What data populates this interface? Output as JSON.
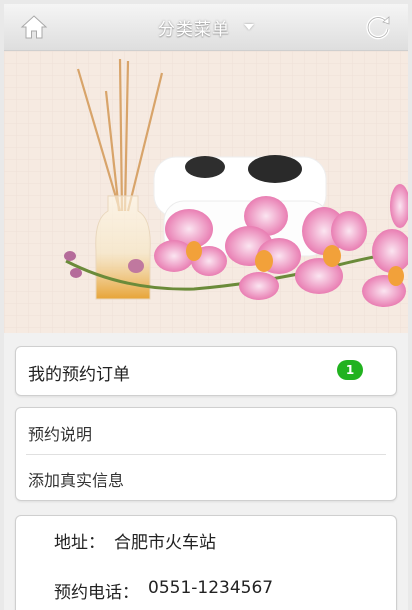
{
  "header": {
    "title": "分类菜单",
    "home_icon": "home-icon",
    "refresh_icon": "refresh-icon",
    "dropdown_icon": "caret-down-icon"
  },
  "banner": {
    "watermark": "spa-candle-flowers-banner"
  },
  "orders": {
    "label": "我的预约订单",
    "count": "1",
    "badge_color": "#21b21f"
  },
  "info": {
    "items": [
      {
        "label": "预约说明"
      },
      {
        "label": "添加真实信息"
      }
    ]
  },
  "contact": {
    "address_label": "地址：",
    "address_value": "合肥市火车站",
    "phone_label": "预约电话：",
    "phone_value": "0551-1234567"
  }
}
